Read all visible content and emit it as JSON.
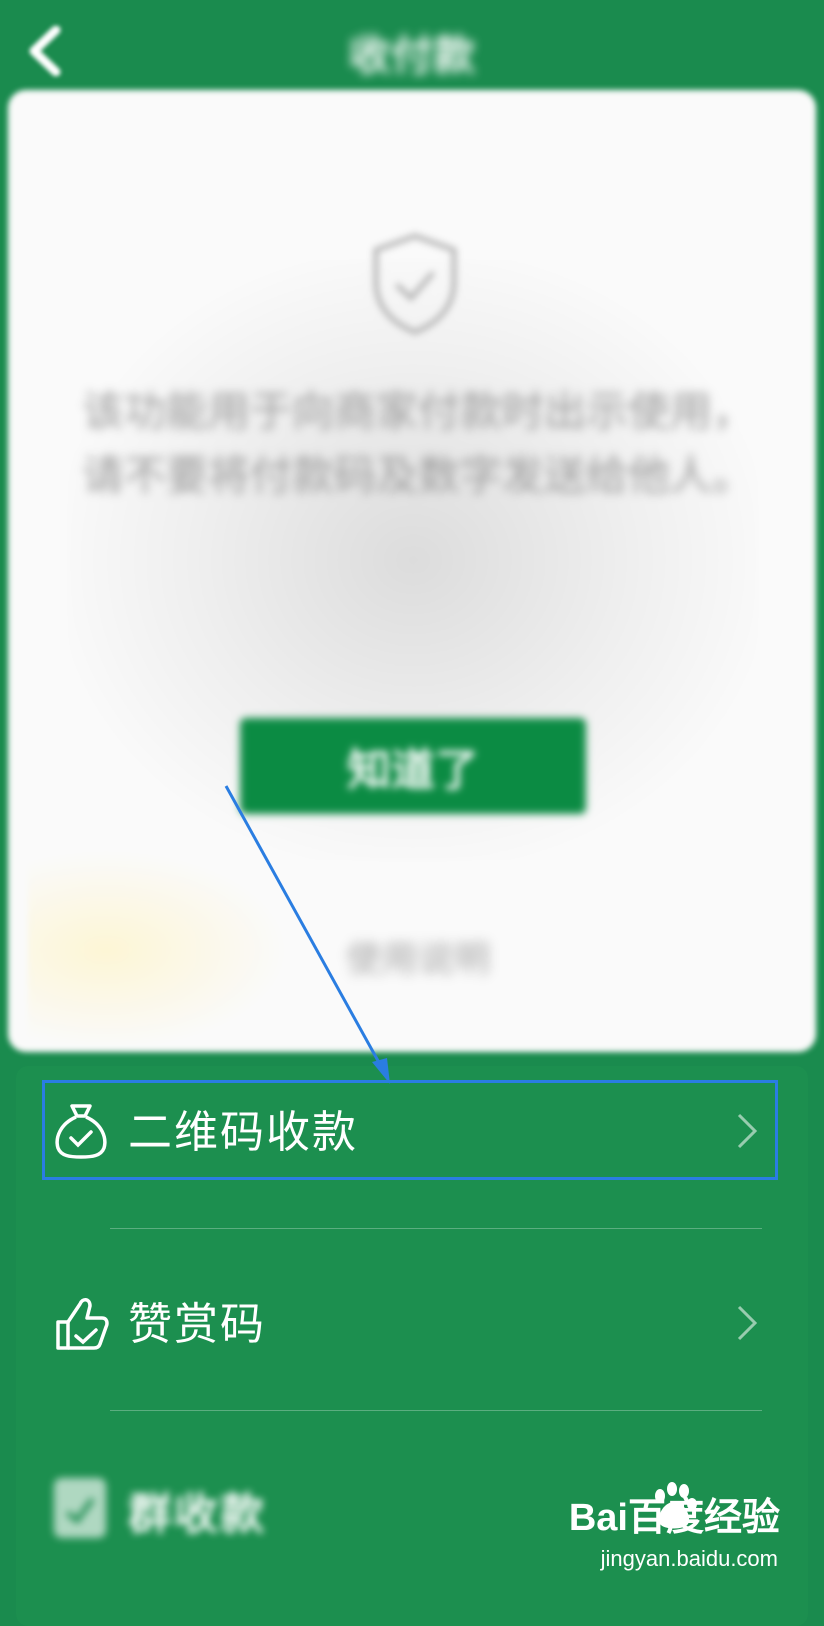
{
  "header": {
    "title": "收付款"
  },
  "card": {
    "notice": "该功能用于向商家付款时出示使用，请不要将付款码及数字发送给他人。",
    "ack_button": "知道了",
    "help_link": "使用说明"
  },
  "menu": {
    "items": [
      {
        "label": "二维码收款",
        "icon": "money-bag-icon"
      },
      {
        "label": "赞赏码",
        "icon": "thumbs-up-icon"
      },
      {
        "label": "群收款",
        "icon": "group-collect-icon"
      }
    ]
  },
  "annotation": {
    "arrow_color": "#2a7de1",
    "highlight_color": "#2a7de1"
  },
  "watermark": {
    "brand": "Bai百度经验",
    "url": "jingyan.baidu.com"
  },
  "colors": {
    "background": "#1a8b4e",
    "button": "#0b8b43",
    "card": "#fafafa"
  }
}
